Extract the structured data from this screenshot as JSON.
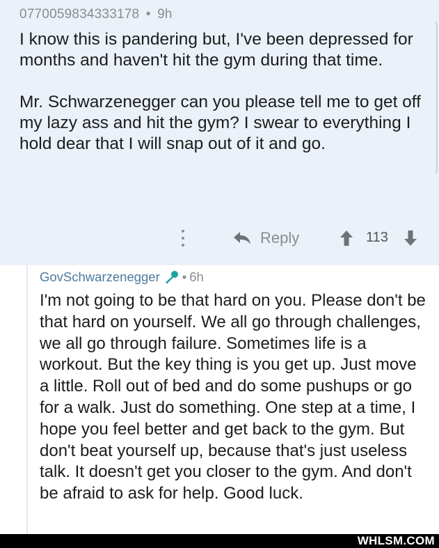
{
  "post": {
    "username": "0770059834333178",
    "separator": "•",
    "age": "9h",
    "paragraphs": [
      "I know this is pandering but, I've been depressed for months and haven't hit the gym during that time.",
      "Mr. Schwarzenegger can you please tell me to get off my lazy ass and hit the gym? I swear to everything I hold dear that I will snap out of it and go."
    ],
    "actions": {
      "more_icon": "vertical-dots-icon",
      "reply_icon": "reply-arrow-icon",
      "reply_label": "Reply",
      "upvote_icon": "up-arrow-icon",
      "score": "113",
      "downvote_icon": "down-arrow-icon"
    }
  },
  "comment": {
    "author": "GovSchwarzenegger",
    "flair_icon": "microphone-icon",
    "separator": "•",
    "age": "6h",
    "body": "I'm not going to be that hard on you. Please don't be that hard on yourself. We all go through challenges, we all go through failure. Sometimes life is a workout. But the key thing is you get up. Just move a little. Roll out of bed and do some pushups or go for a walk. Just do something. One step at a time, I hope you feel better and get back to the gym. But don't beat yourself up, because that's just useless talk. It doesn't get you closer to the gym. And don't be afraid to ask for help. Good luck."
  },
  "watermark": "WHLSM.COM",
  "colors": {
    "post_background": "#eaf1f8",
    "author_link": "#4c7a9c",
    "meta_gray": "#8a8d90",
    "footer_bar": "#000000"
  }
}
